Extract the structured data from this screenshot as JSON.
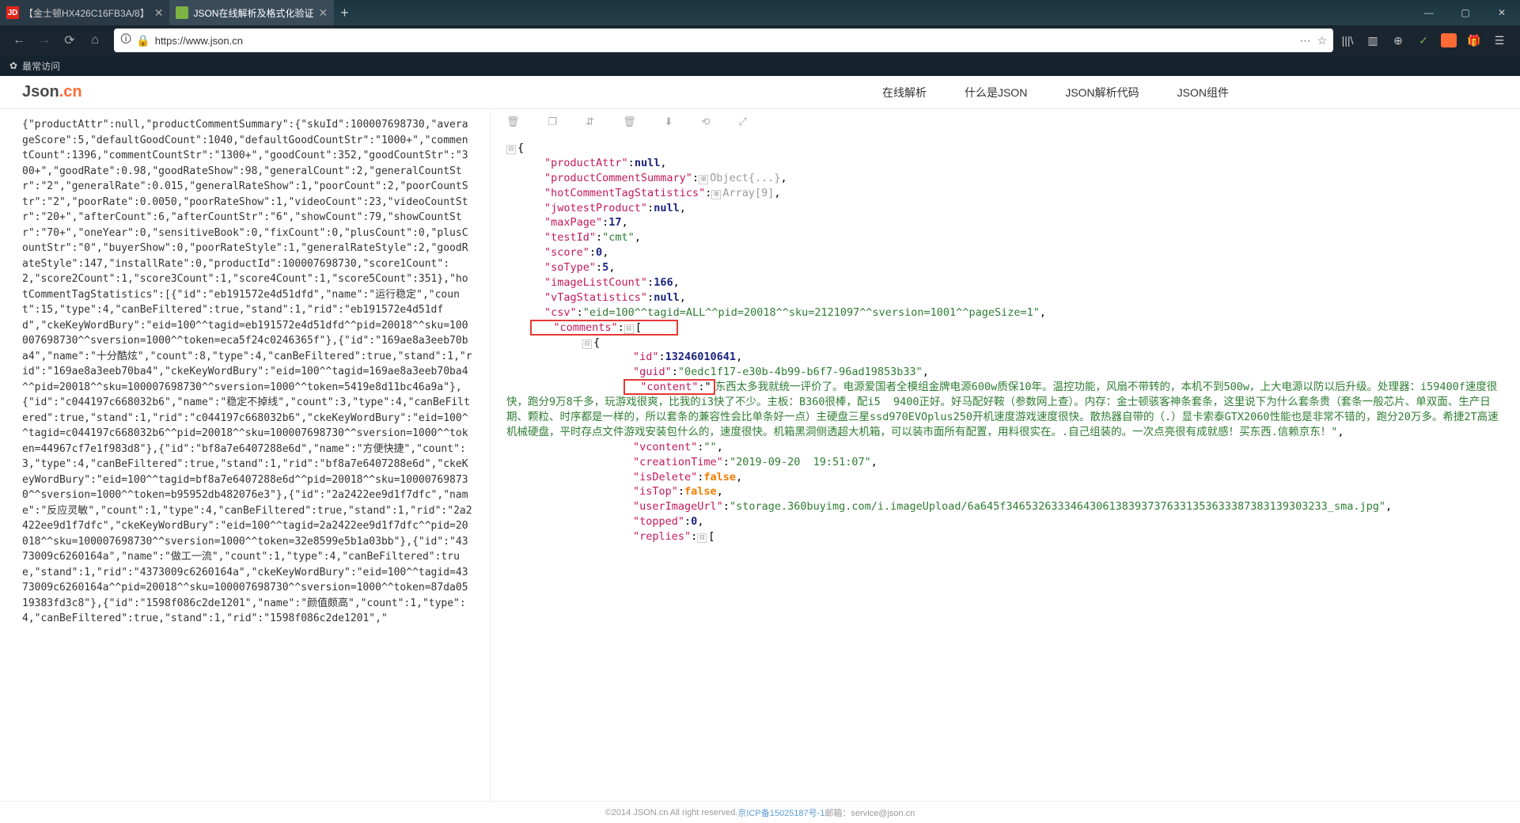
{
  "browser": {
    "tabs": [
      {
        "label": "【金士顿HX426C16FB3A/8】",
        "icon": "JD"
      },
      {
        "label": "JSON在线解析及格式化验证",
        "icon": "json"
      }
    ],
    "url": "https://www.json.cn",
    "bookmark": "最常访问"
  },
  "site": {
    "logo_json": "Json",
    "logo_cn": ".cn",
    "nav": [
      "在线解析",
      "什么是JSON",
      "JSON解析代码",
      "JSON组件"
    ]
  },
  "left_raw": "{\"productAttr\":null,\"productCommentSummary\":{\"skuId\":100007698730,\"averageScore\":5,\"defaultGoodCount\":1040,\"defaultGoodCountStr\":\"1000+\",\"commentCount\":1396,\"commentCountStr\":\"1300+\",\"goodCount\":352,\"goodCountStr\":\"300+\",\"goodRate\":0.98,\"goodRateShow\":98,\"generalCount\":2,\"generalCountStr\":\"2\",\"generalRate\":0.015,\"generalRateShow\":1,\"poorCount\":2,\"poorCountStr\":\"2\",\"poorRate\":0.0050,\"poorRateShow\":1,\"videoCount\":23,\"videoCountStr\":\"20+\",\"afterCount\":6,\"afterCountStr\":\"6\",\"showCount\":79,\"showCountStr\":\"70+\",\"oneYear\":0,\"sensitiveBook\":0,\"fixCount\":0,\"plusCount\":0,\"plusCountStr\":\"0\",\"buyerShow\":0,\"poorRateStyle\":1,\"generalRateStyle\":2,\"goodRateStyle\":147,\"installRate\":0,\"productId\":100007698730,\"score1Count\":2,\"score2Count\":1,\"score3Count\":1,\"score4Count\":1,\"score5Count\":351},\"hotCommentTagStatistics\":[{\"id\":\"eb191572e4d51dfd\",\"name\":\"运行稳定\",\"count\":15,\"type\":4,\"canBeFiltered\":true,\"stand\":1,\"rid\":\"eb191572e4d51dfd\",\"ckeKeyWordBury\":\"eid=100^^tagid=eb191572e4d51dfd^^pid=20018^^sku=100007698730^^sversion=1000^^token=eca5f24c0246365f\"},{\"id\":\"169ae8a3eeb70ba4\",\"name\":\"十分酷炫\",\"count\":8,\"type\":4,\"canBeFiltered\":true,\"stand\":1,\"rid\":\"169ae8a3eeb70ba4\",\"ckeKeyWordBury\":\"eid=100^^tagid=169ae8a3eeb70ba4^^pid=20018^^sku=100007698730^^sversion=1000^^token=5419e8d11bc46a9a\"},{\"id\":\"c044197c668032b6\",\"name\":\"稳定不掉线\",\"count\":3,\"type\":4,\"canBeFiltered\":true,\"stand\":1,\"rid\":\"c044197c668032b6\",\"ckeKeyWordBury\":\"eid=100^^tagid=c044197c668032b6^^pid=20018^^sku=100007698730^^sversion=1000^^token=44967cf7e1f983d8\"},{\"id\":\"bf8a7e6407288e6d\",\"name\":\"方便快捷\",\"count\":3,\"type\":4,\"canBeFiltered\":true,\"stand\":1,\"rid\":\"bf8a7e6407288e6d\",\"ckeKeyWordBury\":\"eid=100^^tagid=bf8a7e6407288e6d^^pid=20018^^sku=100007698730^^sversion=1000^^token=b95952db482076e3\"},{\"id\":\"2a2422ee9d1f7dfc\",\"name\":\"反应灵敏\",\"count\":1,\"type\":4,\"canBeFiltered\":true,\"stand\":1,\"rid\":\"2a2422ee9d1f7dfc\",\"ckeKeyWordBury\":\"eid=100^^tagid=2a2422ee9d1f7dfc^^pid=20018^^sku=100007698730^^sversion=1000^^token=32e8599e5b1a03bb\"},{\"id\":\"4373009c6260164a\",\"name\":\"做工一流\",\"count\":1,\"type\":4,\"canBeFiltered\":true,\"stand\":1,\"rid\":\"4373009c6260164a\",\"ckeKeyWordBury\":\"eid=100^^tagid=4373009c6260164a^^pid=20018^^sku=100007698730^^sversion=1000^^token=87da0519383fd3c8\"},{\"id\":\"1598f086c2de1201\",\"name\":\"颜值颇高\",\"count\":1,\"type\":4,\"canBeFiltered\":true,\"stand\":1,\"rid\":\"1598f086c2de1201\",\"",
  "tree": {
    "productAttr_k": "\"productAttr\"",
    "productAttr_v": "null",
    "pcs_k": "\"productCommentSummary\"",
    "pcs_v": "Object{...}",
    "hcts_k": "\"hotCommentTagStatistics\"",
    "hcts_v": "Array[9]",
    "jwo_k": "\"jwotestProduct\"",
    "jwo_v": "null",
    "maxPage_k": "\"maxPage\"",
    "maxPage_v": "17",
    "testId_k": "\"testId\"",
    "testId_v": "\"cmt\"",
    "score_k": "\"score\"",
    "score_v": "0",
    "soType_k": "\"soType\"",
    "soType_v": "5",
    "ilc_k": "\"imageListCount\"",
    "ilc_v": "166",
    "vtag_k": "\"vTagStatistics\"",
    "vtag_v": "null",
    "csv_k": "\"csv\"",
    "csv_v": "\"eid=100^^tagid=ALL^^pid=20018^^sku=2121097^^sversion=1001^^pageSize=1\"",
    "comments_k": "\"comments\"",
    "id_k": "\"id\"",
    "id_v": "13246010641",
    "guid_k": "\"guid\"",
    "guid_v": "\"0edc1f17-e30b-4b99-b6f7-96ad19853b33\"",
    "content_k": "\"content\"",
    "content_v": "东西太多我就统一评价了。电源爱国者全模组金牌电源600w质保10年。温控功能，风扇不带转的，本机不到500w，上大电源以防以后升级。处理器：i59400f速度很快，跑分9万8千多，玩游戏很爽，比我的i3快了不少。主板：B360很棒，配i5  9400正好。好马配好鞍（参数网上查）。内存：金士顿骇客神条套条，这里说下为什么套条贵（套条一般芯片、单双面、生产日期、颗粒、时序都是一样的，所以套条的兼容性会比单条好一点）主硬盘三星ssd970EVOplus250开机速度游戏速度很快。散热器自带的（.）显卡索泰GTX2060性能也是非常不错的，跑分20万多。希捷2T高速机械硬盘，平时存点文件游戏安装包什么的，速度很快。机箱黑洞侧透超大机箱，可以装市面所有配置，用料很实在。.自己组装的。一次点亮很有成就感！买东西.信赖京东！\"",
    "vcontent_k": "\"vcontent\"",
    "vcontent_v": "\"\"",
    "ctime_k": "\"creationTime\"",
    "ctime_v": "\"2019-09-20  19:51:07\"",
    "isDel_k": "\"isDelete\"",
    "isDel_v": "false",
    "isTop_k": "\"isTop\"",
    "isTop_v": "false",
    "uimg_k": "\"userImageUrl\"",
    "uimg_v": "\"storage.360buyimg.com/i.imageUpload/6a645f34653263334643061383937376331353633387383139303233_sma.jpg\"",
    "topped_k": "\"topped\"",
    "topped_v": "0",
    "replies_k": "\"replies\""
  },
  "footer": {
    "copyright": "©2014 JSON.cn All right reserved. ",
    "icp": "京ICP备15025187号-1",
    "email": " 邮箱：service@json.cn"
  }
}
